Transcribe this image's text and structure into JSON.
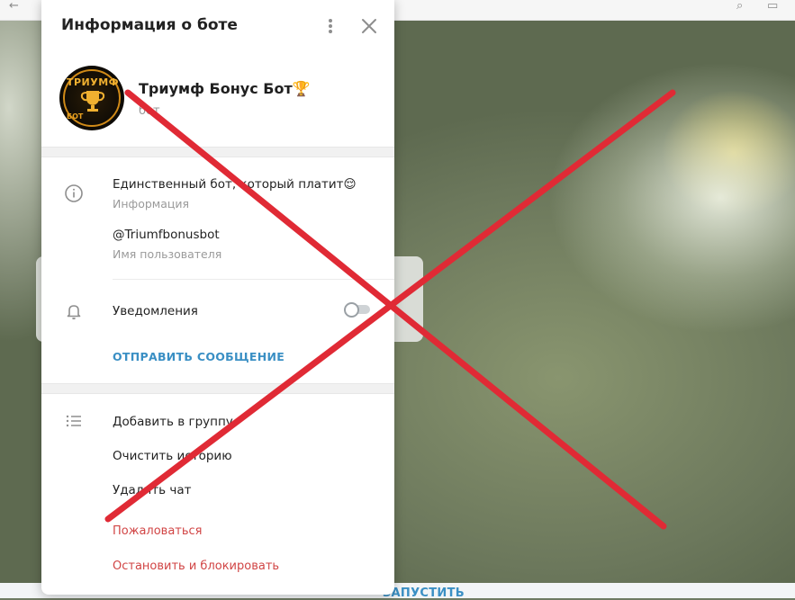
{
  "panel": {
    "title": "Информация о боте",
    "menu_icon": "more-vertical-icon",
    "close_icon": "close-icon"
  },
  "bot": {
    "name": "Триумф Бонус Бот🏆",
    "subtitle": "бот",
    "avatar": {
      "top_text": "ТРИУМФ",
      "bottom_text": "БОТ",
      "icon": "trophy-icon"
    }
  },
  "info": {
    "description": "Единственный бот, который платит😌",
    "description_label": "Информация",
    "username": "@Triumfbonusbot",
    "username_label": "Имя пользователя"
  },
  "notifications": {
    "label": "Уведомления",
    "enabled": false
  },
  "send_message_label": "ОТПРАВИТЬ СООБЩЕНИЕ",
  "actions": {
    "add_to_group": "Добавить в группу",
    "clear_history": "Очистить историю",
    "delete_chat": "Удалить чат",
    "report": "Пожаловаться",
    "stop_and_block": "Остановить и блокировать"
  },
  "background": {
    "start_button": "ЗАПУСТИТЬ"
  },
  "overlay": {
    "cross_color": "#e02a35"
  }
}
